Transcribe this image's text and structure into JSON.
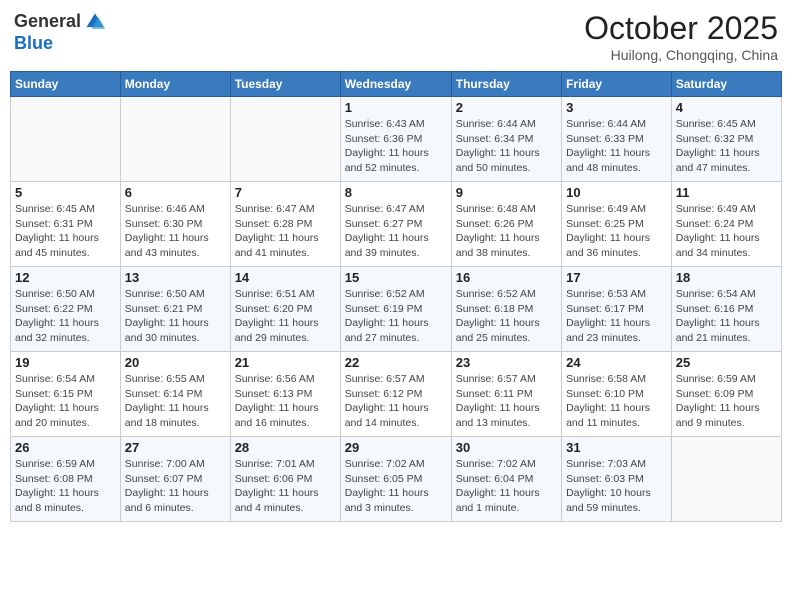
{
  "header": {
    "logo_line1": "General",
    "logo_line2": "Blue",
    "month": "October 2025",
    "location": "Huilong, Chongqing, China"
  },
  "weekdays": [
    "Sunday",
    "Monday",
    "Tuesday",
    "Wednesday",
    "Thursday",
    "Friday",
    "Saturday"
  ],
  "weeks": [
    [
      {
        "day": "",
        "info": ""
      },
      {
        "day": "",
        "info": ""
      },
      {
        "day": "",
        "info": ""
      },
      {
        "day": "1",
        "info": "Sunrise: 6:43 AM\nSunset: 6:36 PM\nDaylight: 11 hours\nand 52 minutes."
      },
      {
        "day": "2",
        "info": "Sunrise: 6:44 AM\nSunset: 6:34 PM\nDaylight: 11 hours\nand 50 minutes."
      },
      {
        "day": "3",
        "info": "Sunrise: 6:44 AM\nSunset: 6:33 PM\nDaylight: 11 hours\nand 48 minutes."
      },
      {
        "day": "4",
        "info": "Sunrise: 6:45 AM\nSunset: 6:32 PM\nDaylight: 11 hours\nand 47 minutes."
      }
    ],
    [
      {
        "day": "5",
        "info": "Sunrise: 6:45 AM\nSunset: 6:31 PM\nDaylight: 11 hours\nand 45 minutes."
      },
      {
        "day": "6",
        "info": "Sunrise: 6:46 AM\nSunset: 6:30 PM\nDaylight: 11 hours\nand 43 minutes."
      },
      {
        "day": "7",
        "info": "Sunrise: 6:47 AM\nSunset: 6:28 PM\nDaylight: 11 hours\nand 41 minutes."
      },
      {
        "day": "8",
        "info": "Sunrise: 6:47 AM\nSunset: 6:27 PM\nDaylight: 11 hours\nand 39 minutes."
      },
      {
        "day": "9",
        "info": "Sunrise: 6:48 AM\nSunset: 6:26 PM\nDaylight: 11 hours\nand 38 minutes."
      },
      {
        "day": "10",
        "info": "Sunrise: 6:49 AM\nSunset: 6:25 PM\nDaylight: 11 hours\nand 36 minutes."
      },
      {
        "day": "11",
        "info": "Sunrise: 6:49 AM\nSunset: 6:24 PM\nDaylight: 11 hours\nand 34 minutes."
      }
    ],
    [
      {
        "day": "12",
        "info": "Sunrise: 6:50 AM\nSunset: 6:22 PM\nDaylight: 11 hours\nand 32 minutes."
      },
      {
        "day": "13",
        "info": "Sunrise: 6:50 AM\nSunset: 6:21 PM\nDaylight: 11 hours\nand 30 minutes."
      },
      {
        "day": "14",
        "info": "Sunrise: 6:51 AM\nSunset: 6:20 PM\nDaylight: 11 hours\nand 29 minutes."
      },
      {
        "day": "15",
        "info": "Sunrise: 6:52 AM\nSunset: 6:19 PM\nDaylight: 11 hours\nand 27 minutes."
      },
      {
        "day": "16",
        "info": "Sunrise: 6:52 AM\nSunset: 6:18 PM\nDaylight: 11 hours\nand 25 minutes."
      },
      {
        "day": "17",
        "info": "Sunrise: 6:53 AM\nSunset: 6:17 PM\nDaylight: 11 hours\nand 23 minutes."
      },
      {
        "day": "18",
        "info": "Sunrise: 6:54 AM\nSunset: 6:16 PM\nDaylight: 11 hours\nand 21 minutes."
      }
    ],
    [
      {
        "day": "19",
        "info": "Sunrise: 6:54 AM\nSunset: 6:15 PM\nDaylight: 11 hours\nand 20 minutes."
      },
      {
        "day": "20",
        "info": "Sunrise: 6:55 AM\nSunset: 6:14 PM\nDaylight: 11 hours\nand 18 minutes."
      },
      {
        "day": "21",
        "info": "Sunrise: 6:56 AM\nSunset: 6:13 PM\nDaylight: 11 hours\nand 16 minutes."
      },
      {
        "day": "22",
        "info": "Sunrise: 6:57 AM\nSunset: 6:12 PM\nDaylight: 11 hours\nand 14 minutes."
      },
      {
        "day": "23",
        "info": "Sunrise: 6:57 AM\nSunset: 6:11 PM\nDaylight: 11 hours\nand 13 minutes."
      },
      {
        "day": "24",
        "info": "Sunrise: 6:58 AM\nSunset: 6:10 PM\nDaylight: 11 hours\nand 11 minutes."
      },
      {
        "day": "25",
        "info": "Sunrise: 6:59 AM\nSunset: 6:09 PM\nDaylight: 11 hours\nand 9 minutes."
      }
    ],
    [
      {
        "day": "26",
        "info": "Sunrise: 6:59 AM\nSunset: 6:08 PM\nDaylight: 11 hours\nand 8 minutes."
      },
      {
        "day": "27",
        "info": "Sunrise: 7:00 AM\nSunset: 6:07 PM\nDaylight: 11 hours\nand 6 minutes."
      },
      {
        "day": "28",
        "info": "Sunrise: 7:01 AM\nSunset: 6:06 PM\nDaylight: 11 hours\nand 4 minutes."
      },
      {
        "day": "29",
        "info": "Sunrise: 7:02 AM\nSunset: 6:05 PM\nDaylight: 11 hours\nand 3 minutes."
      },
      {
        "day": "30",
        "info": "Sunrise: 7:02 AM\nSunset: 6:04 PM\nDaylight: 11 hours\nand 1 minute."
      },
      {
        "day": "31",
        "info": "Sunrise: 7:03 AM\nSunset: 6:03 PM\nDaylight: 10 hours\nand 59 minutes."
      },
      {
        "day": "",
        "info": ""
      }
    ]
  ]
}
